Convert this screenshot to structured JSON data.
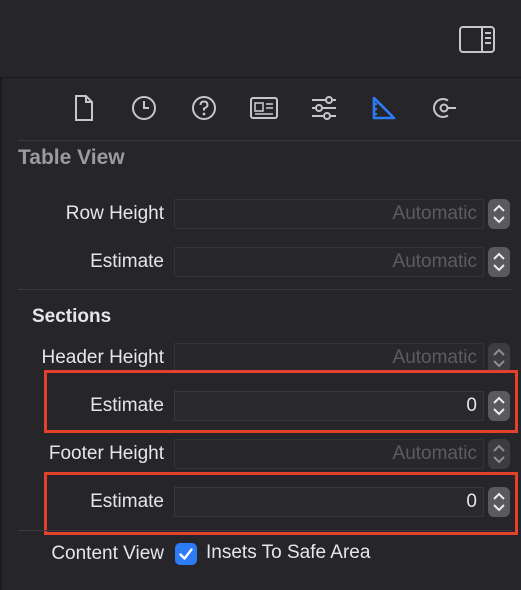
{
  "toolbar": {
    "tabs": [
      {
        "icon": "file-icon"
      },
      {
        "icon": "history-icon"
      },
      {
        "icon": "help-icon"
      },
      {
        "icon": "identity-icon"
      },
      {
        "icon": "attributes-icon"
      },
      {
        "icon": "size-ruler-icon",
        "selected": true
      },
      {
        "icon": "connections-icon"
      }
    ],
    "accent": "#2e7bf6"
  },
  "section": {
    "title": "Table View",
    "row_height_label": "Row Height",
    "row_height_value": "Automatic",
    "row_estimate_label": "Estimate",
    "row_estimate_value": "Automatic",
    "sections_label": "Sections",
    "header_height_label": "Header Height",
    "header_height_value": "Automatic",
    "header_estimate_label": "Estimate",
    "header_estimate_value": "0",
    "footer_height_label": "Footer Height",
    "footer_height_value": "Automatic",
    "footer_estimate_label": "Estimate",
    "footer_estimate_value": "0",
    "content_view_label": "Content View",
    "insets_checkbox_label": "Insets To Safe Area",
    "insets_checked": true
  },
  "colors": {
    "highlight": "#e2412c",
    "background": "#26252a"
  }
}
